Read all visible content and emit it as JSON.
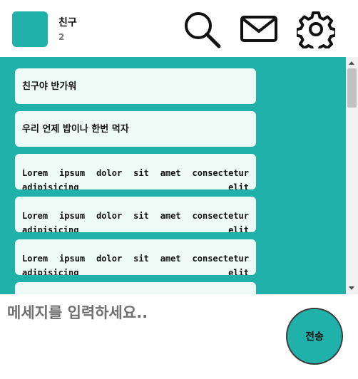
{
  "header": {
    "room_name": "친구",
    "member_count": "2",
    "avatar_color": "#20b2aa",
    "icons": [
      "search-icon",
      "mail-icon",
      "gear-icon"
    ]
  },
  "messages": [
    {
      "text": "친구야 반가워"
    },
    {
      "text": "우리 언제 밥이나 한번 먹자"
    },
    {
      "text": "Lorem ipsum dolor sit amet consectetur adipisicing elit"
    },
    {
      "text": "Lorem ipsum dolor sit amet consectetur adipisicing elit"
    },
    {
      "text": "Lorem ipsum dolor sit amet consectetur adipisicing elit"
    },
    {
      "text": ""
    }
  ],
  "composer": {
    "placeholder": "메세지를 입력하세요..",
    "send_label": "전송"
  },
  "colors": {
    "accent": "#20b2aa",
    "bubble": "#edfaf6"
  }
}
